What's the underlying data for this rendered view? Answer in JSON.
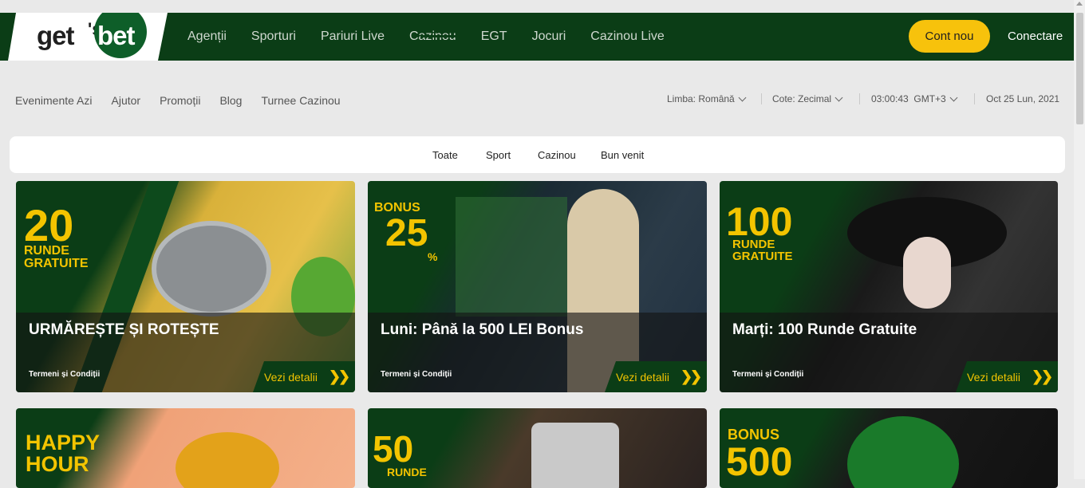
{
  "brand": {
    "text_left": "get",
    "text_right": "bet"
  },
  "nav": {
    "items": [
      "Agenții",
      "Sporturi",
      "Pariuri Live",
      "Cazinou",
      "EGT",
      "Jocuri",
      "Cazinou Live"
    ],
    "register": "Cont nou",
    "login": "Conectare"
  },
  "secondary": {
    "links": [
      "Evenimente Azi",
      "Ajutor",
      "Promoții",
      "Blog",
      "Turnee Cazinou"
    ],
    "lang_label": "Limba:",
    "lang_value": "Română",
    "odds_label": "Cote:",
    "odds_value": "Zecimal",
    "time": "03:00:43",
    "tz": "GMT+3",
    "date": "Oct 25 Lun, 2021"
  },
  "tabs": [
    "Toate",
    "Sport",
    "Cazinou",
    "Bun venit"
  ],
  "cards": [
    {
      "title": "URMĂREȘTE ȘI ROTEȘTE",
      "terms": "Termeni și Condiții",
      "cta": "Vezi detalii",
      "big": "20",
      "sub": "RUNDE GRATUITE"
    },
    {
      "title": "Luni: Până la 500 LEI Bonus",
      "terms": "Termeni și Condiții",
      "cta": "Vezi detalii",
      "big": "25",
      "sub": "BONUS",
      "pct": "%"
    },
    {
      "title": "Marți: 100 Runde Gratuite",
      "terms": "Termeni și Condiții",
      "cta": "Vezi detalii",
      "big": "100",
      "sub": "RUNDE GRATUITE"
    },
    {
      "big": "HAPPY HOUR"
    },
    {
      "big": "50",
      "sub": "RUNDE"
    },
    {
      "big": "500",
      "sub": "BONUS"
    }
  ],
  "colors": {
    "brand_green": "#0b3d16",
    "accent_yellow": "#f7c20c"
  }
}
